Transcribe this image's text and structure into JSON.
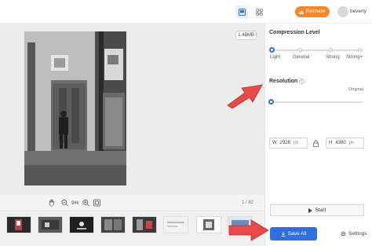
{
  "header": {
    "purchase_label": "Purchase",
    "username": "beverly"
  },
  "preview": {
    "file_size": "1.48MB",
    "zoom_level": "9%",
    "page_indicator": "1 / 82"
  },
  "panel": {
    "compression_title": "Compression Level",
    "levels": [
      "Light",
      "General",
      "Strong",
      "Strong+"
    ],
    "selected_level": "Light",
    "resolution_title": "Resolution",
    "resolution_mode": "Original",
    "width_label": "W",
    "width_value": "2926",
    "width_unit": "px",
    "height_label": "H",
    "height_value": "4380",
    "height_unit": "px",
    "start_label": "Start",
    "save_all_label": "Save All",
    "settings_label": "Settings"
  },
  "colors": {
    "accent": "#2f6fe0",
    "purchase": "#f5862a",
    "annotation_arrow": "#e84a4a"
  },
  "icons": [
    "single-view-icon",
    "grid-view-icon",
    "crown-icon",
    "hand-icon",
    "zoom-out-icon",
    "zoom-in-icon",
    "fit-icon",
    "info-icon",
    "lock-icon",
    "play-icon",
    "download-icon",
    "gear-icon"
  ]
}
